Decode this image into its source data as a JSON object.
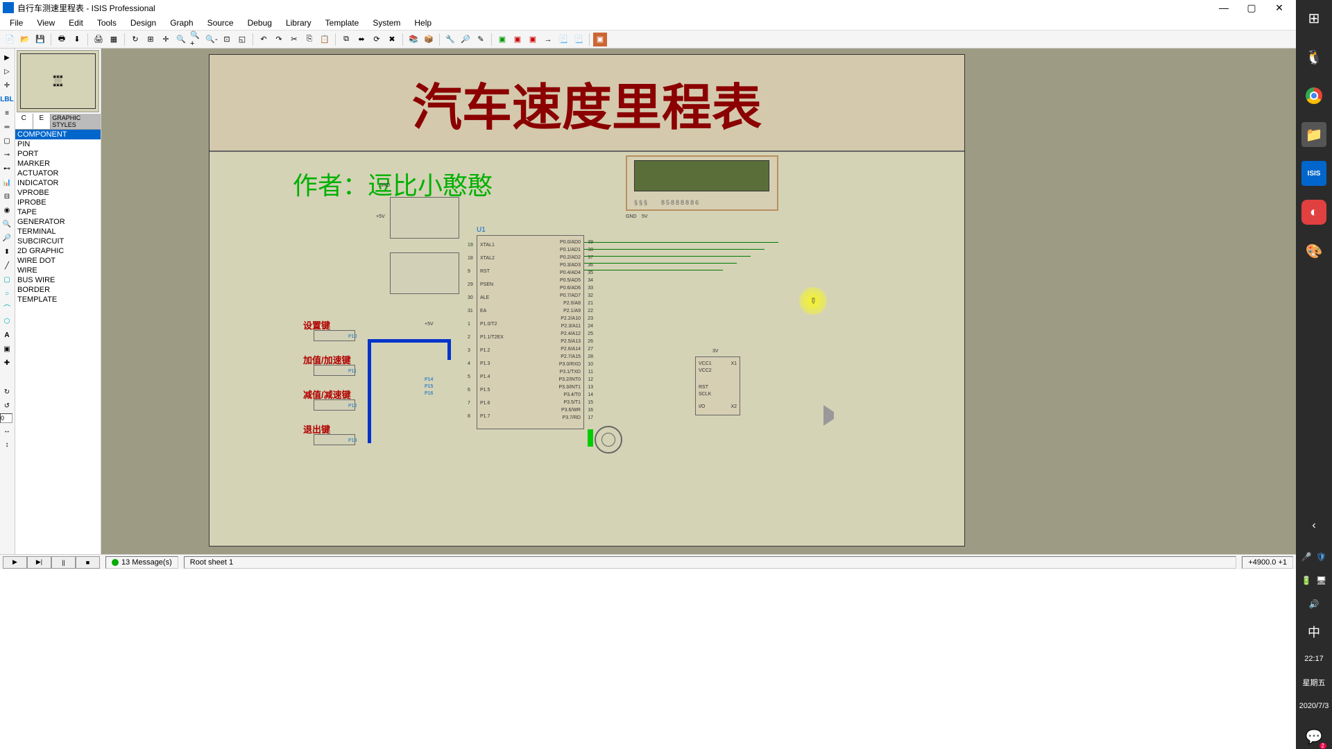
{
  "window": {
    "title": "自行车测速里程表 - ISIS Professional",
    "min": "—",
    "max": "▢",
    "close": "✕"
  },
  "menu": {
    "file": "File",
    "view": "View",
    "edit": "Edit",
    "tools": "Tools",
    "design": "Design",
    "graph": "Graph",
    "source": "Source",
    "debug": "Debug",
    "library": "Library",
    "template": "Template",
    "system": "System",
    "help": "Help"
  },
  "browser": {
    "tab_c": "C",
    "tab_e": "E",
    "header": "GRAPHIC STYLES",
    "items": [
      "COMPONENT",
      "PIN",
      "PORT",
      "MARKER",
      "ACTUATOR",
      "INDICATOR",
      "VPROBE",
      "IPROBE",
      "TAPE",
      "GENERATOR",
      "TERMINAL",
      "SUBCIRCUIT",
      "2D GRAPHIC",
      "WIRE DOT",
      "WIRE",
      "BUS WIRE",
      "BORDER",
      "TEMPLATE"
    ],
    "selected": 0
  },
  "schematic": {
    "title": "汽车速度里程表",
    "author_label": "作者：逗比小憨憨",
    "chip_ref": "U1",
    "buttons": {
      "set": "设置键",
      "inc": "加值/加速键",
      "dec": "减值/减速键",
      "exit": "退出键"
    },
    "pin_labels": {
      "p10": "P10",
      "p11": "P11",
      "p12": "P12",
      "p13": "P13",
      "p14": "P14",
      "p15": "P15",
      "p16": "P16"
    },
    "chip_pins_left": [
      "XTAL1",
      "XTAL2",
      "RST",
      "PSEN",
      "ALE",
      "EA",
      "P1.0/T2",
      "P1.1/T2EX",
      "P1.2",
      "P1.3",
      "P1.4",
      "P1.5",
      "P1.6",
      "P1.7"
    ],
    "chip_pins_right": [
      "P0.0/AD0",
      "P0.1/AD1",
      "P0.2/AD2",
      "P0.3/AD3",
      "P0.4/AD4",
      "P0.5/AD5",
      "P0.6/AD6",
      "P0.7/AD7",
      "P2.0/A8",
      "P2.1/A9",
      "P2.2/A10",
      "P2.3/A11",
      "P2.4/A12",
      "P2.5/A13",
      "P2.6/A14",
      "P2.7/A15",
      "P3.0/RXD",
      "P3.1/TXD",
      "P3.2/INT0",
      "P3.3/INT1",
      "P3.4/T0",
      "P3.5/T1",
      "P3.6/WR",
      "P3.7/RD"
    ],
    "chip_nums_left": [
      "19",
      "18",
      "9",
      "29",
      "30",
      "31",
      "1",
      "2",
      "3",
      "4",
      "5",
      "6",
      "7",
      "8"
    ],
    "chip_nums_right": [
      "39",
      "38",
      "37",
      "36",
      "35",
      "34",
      "33",
      "32",
      "21",
      "22",
      "23",
      "24",
      "25",
      "26",
      "27",
      "28",
      "10",
      "11",
      "12",
      "13",
      "14",
      "15",
      "16",
      "17"
    ],
    "rtc_pins": [
      "VCC1",
      "VCC2",
      "RST",
      "SCLK",
      "I/O"
    ],
    "rtc_refs": [
      "X1",
      "X2"
    ],
    "power": {
      "gnd": "GND",
      "vcc5": "+5V",
      "v3": "3V",
      "v5": "5V"
    },
    "lcd_digits": "85888886"
  },
  "status": {
    "messages": "13 Message(s)",
    "sheet": "Root sheet 1",
    "coords": "+4900.0  +1"
  },
  "leftbar_input": "0",
  "dock": {
    "time": "22:17",
    "day": "星期五",
    "date": "2020/7/3",
    "ime": "中"
  }
}
